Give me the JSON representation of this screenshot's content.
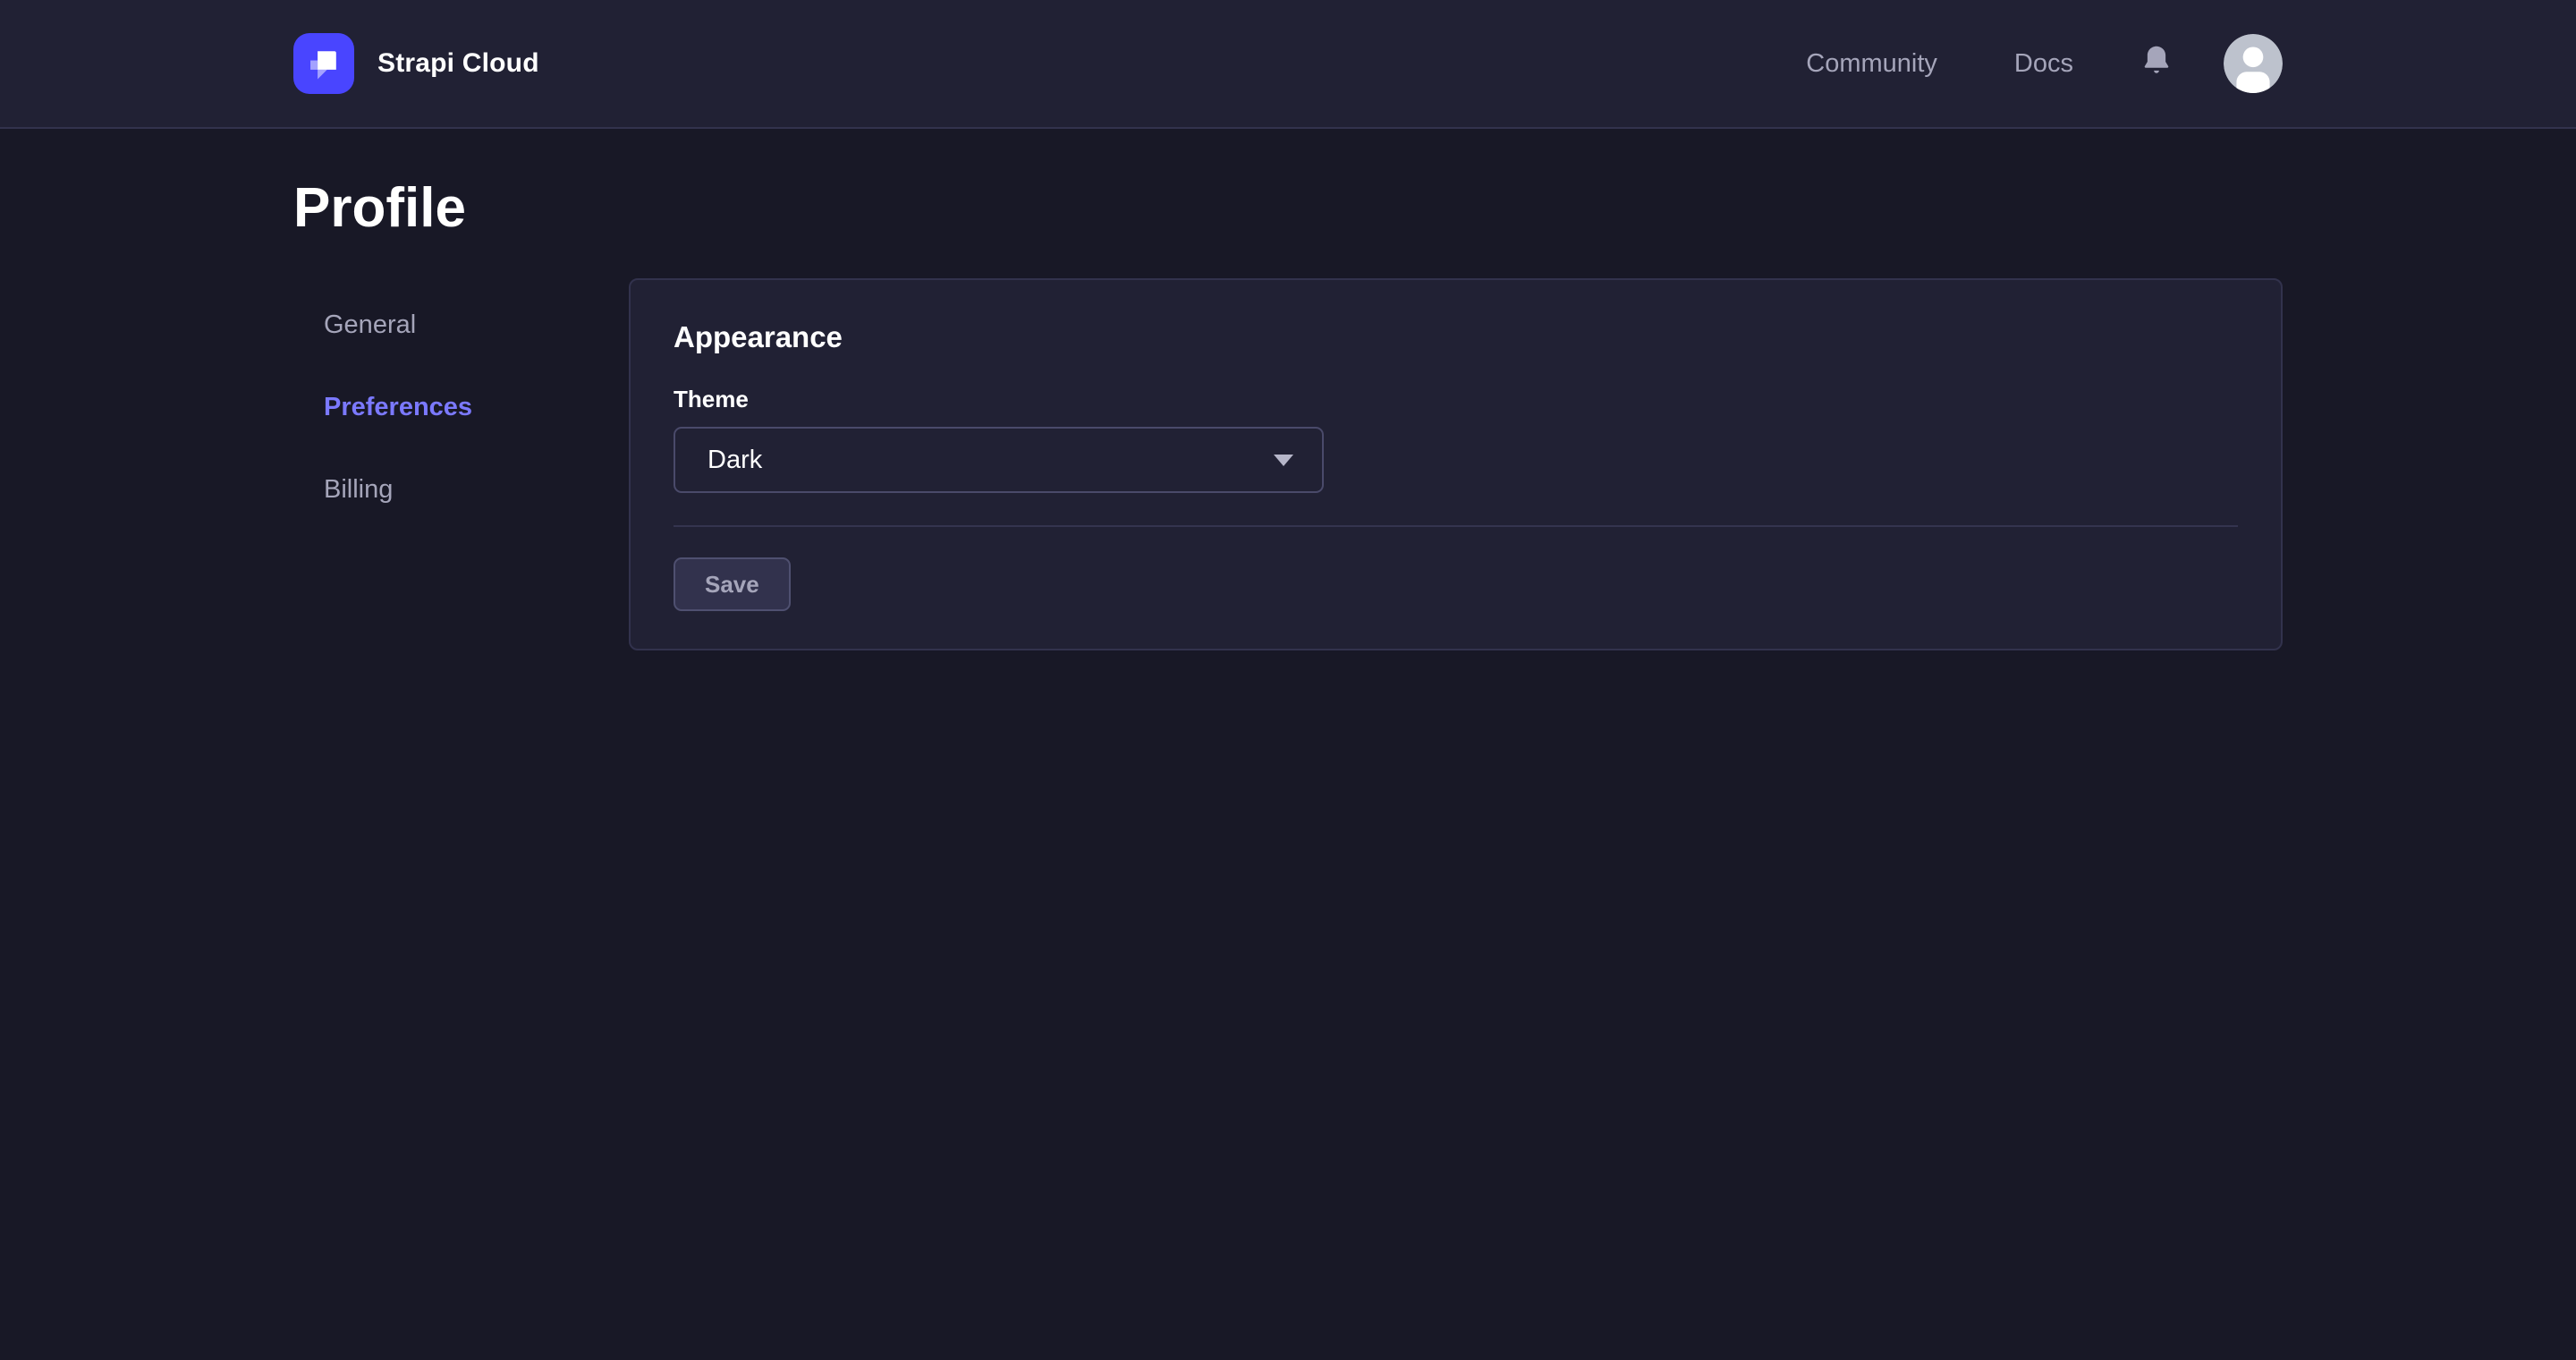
{
  "colors": {
    "page_bg": "#181826",
    "surface_bg": "#212134",
    "border": "#32324d",
    "input_border": "#4a4a6a",
    "text_primary": "#ffffff",
    "text_muted": "#a5a5ba",
    "brand_primary": "#4945ff",
    "active_link": "#7b79ff",
    "avatar_bg": "#bdc2cd"
  },
  "header": {
    "brand": "Strapi Cloud",
    "nav": [
      {
        "label": "Community"
      },
      {
        "label": "Docs"
      }
    ],
    "icons": [
      {
        "name": "bell-icon"
      },
      {
        "name": "user-avatar"
      }
    ]
  },
  "page": {
    "title": "Profile"
  },
  "sidebar": {
    "items": [
      {
        "label": "General",
        "active": false
      },
      {
        "label": "Preferences",
        "active": true
      },
      {
        "label": "Billing",
        "active": false
      }
    ]
  },
  "appearance_card": {
    "title": "Appearance",
    "theme": {
      "label": "Theme",
      "selected": "Dark"
    },
    "save_label": "Save"
  }
}
